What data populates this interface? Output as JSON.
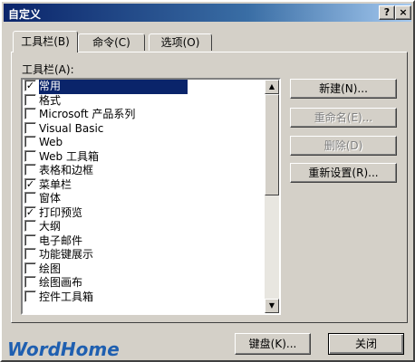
{
  "window": {
    "title": "自定义",
    "help_icon": "?",
    "close_icon": "×"
  },
  "tabs": [
    {
      "label": "工具栏(B)"
    },
    {
      "label": "命令(C)"
    },
    {
      "label": "选项(O)"
    }
  ],
  "toolbars": {
    "label": "工具栏(A):",
    "items": [
      {
        "label": "常用",
        "checked": true,
        "selected": true
      },
      {
        "label": "格式",
        "checked": false
      },
      {
        "label": "Microsoft 产品系列",
        "checked": false
      },
      {
        "label": "Visual Basic",
        "checked": false
      },
      {
        "label": "Web",
        "checked": false
      },
      {
        "label": "Web 工具箱",
        "checked": false
      },
      {
        "label": "表格和边框",
        "checked": false
      },
      {
        "label": "菜单栏",
        "checked": true
      },
      {
        "label": "窗体",
        "checked": false
      },
      {
        "label": "打印预览",
        "checked": true
      },
      {
        "label": "大纲",
        "checked": false
      },
      {
        "label": "电子邮件",
        "checked": false
      },
      {
        "label": "功能键展示",
        "checked": false
      },
      {
        "label": "绘图",
        "checked": false
      },
      {
        "label": "绘图画布",
        "checked": false
      },
      {
        "label": "控件工具箱",
        "checked": false
      }
    ]
  },
  "side_buttons": {
    "new": "新建(N)...",
    "rename": "重命名(E)...",
    "delete": "删除(D)",
    "reset": "重新设置(R)..."
  },
  "bottom_buttons": {
    "keyboard": "键盘(K)...",
    "close": "关闭"
  },
  "watermark": "WordHome"
}
